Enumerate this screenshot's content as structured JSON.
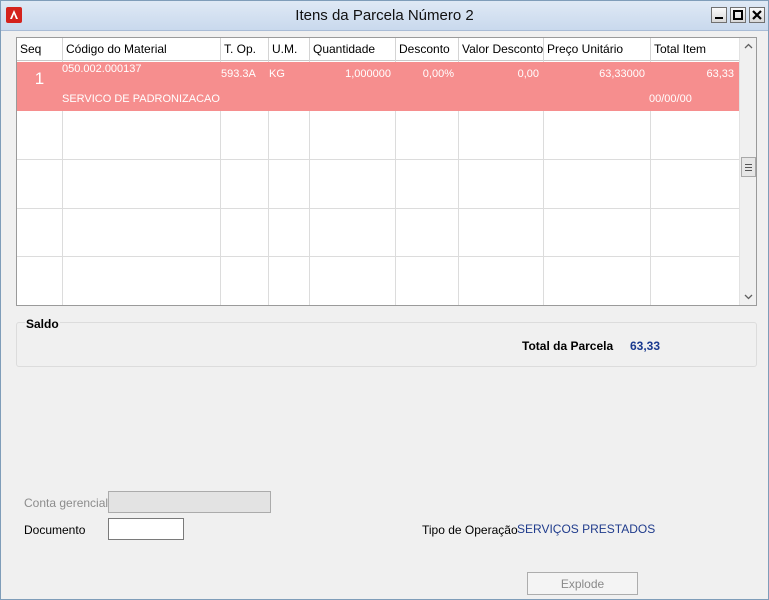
{
  "window": {
    "title": "Itens da Parcela Número 2"
  },
  "grid": {
    "columns": [
      "Seq",
      "Código do Material",
      "T. Op.",
      "U.M.",
      "Quantidade",
      "Desconto",
      "Valor Desconto",
      "Preço Unitário",
      "Total Item"
    ],
    "rows": [
      {
        "seq": "1",
        "codigo": "050.002.000137",
        "top": "593.3A",
        "um": "KG",
        "quantidade": "1,000000",
        "desconto": "0,00%",
        "valor_desconto": "0,00",
        "preco_unitario": "63,33000",
        "total_item": "63,33",
        "descricao": "SERVICO DE PADRONIZACAO",
        "data": "00/00/00"
      }
    ]
  },
  "saldo": {
    "title": "Saldo",
    "total_label": "Total da Parcela",
    "total_value": "63,33"
  },
  "form": {
    "conta_label": "Conta gerencial",
    "conta_value": "",
    "documento_label": "Documento",
    "documento_value": "",
    "tipo_operacao_label": "Tipo de Operação",
    "tipo_operacao_value": "SERVIÇOS PRESTADOS",
    "explode_label": "Explode"
  },
  "colors": {
    "selected_row": "#f68e8e",
    "accent_value": "#1f3b8c"
  }
}
